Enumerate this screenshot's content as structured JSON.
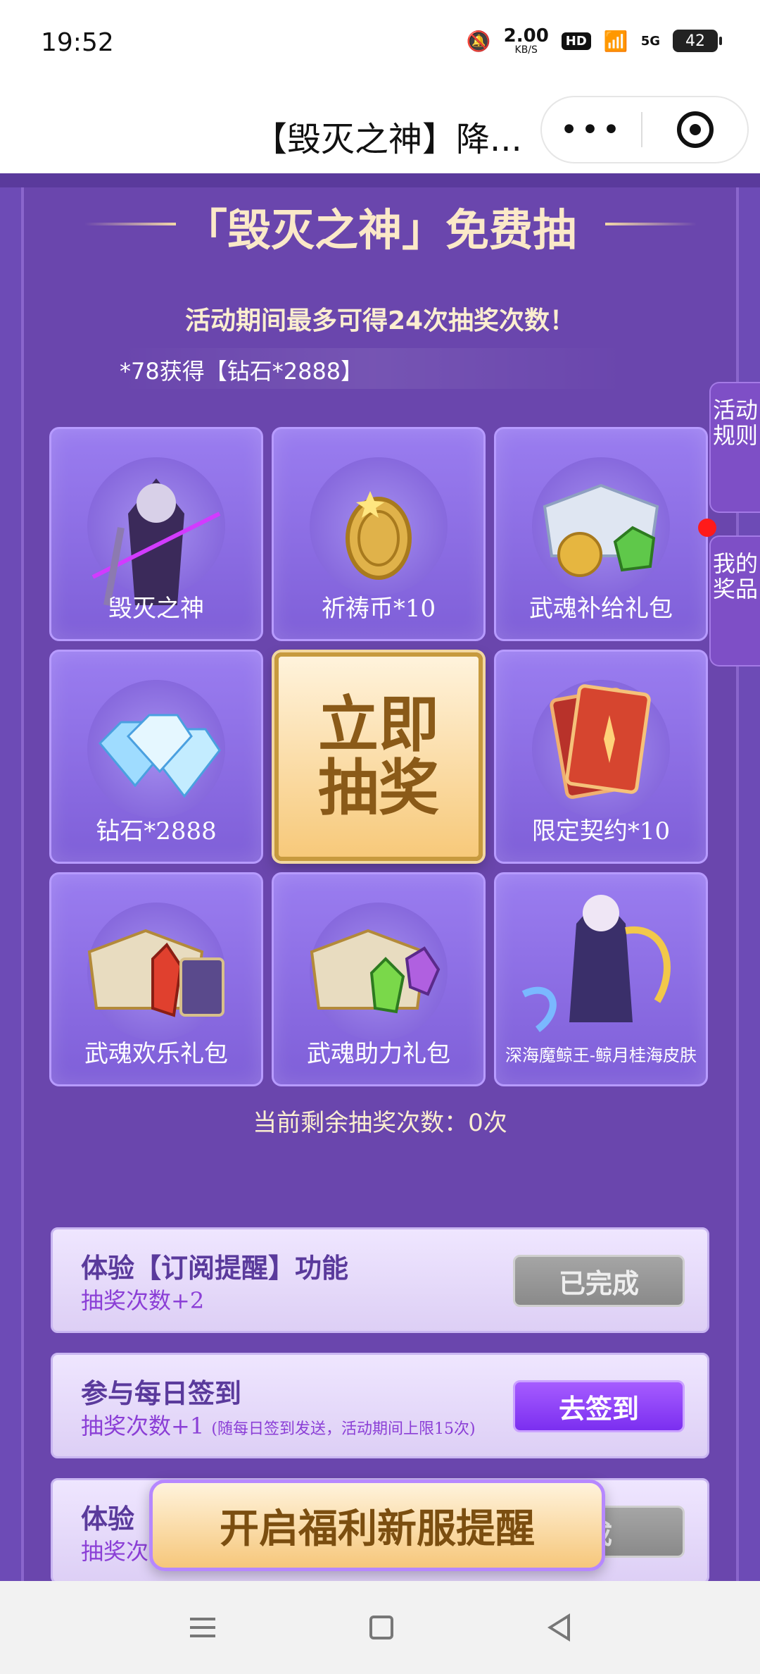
{
  "status_bar": {
    "time": "19:52",
    "net_speed_value": "2.00",
    "net_speed_unit": "KB/S",
    "hd_label": "HD",
    "signal_label": "5G",
    "battery": "42"
  },
  "title_bar": {
    "title": "【毁灭之神】降...",
    "more_glyph": "•••"
  },
  "event": {
    "title": "「毁灭之神」免费抽",
    "subtitle": "活动期间最多可得24次抽奖次数！",
    "marquee": "*78获得【钻石*2888】"
  },
  "prizes": [
    {
      "label": "毁灭之神",
      "icon": "character-icon"
    },
    {
      "label": "祈祷币*10",
      "icon": "coin-icon"
    },
    {
      "label": "武魂补给礼包",
      "icon": "chest-icon"
    },
    {
      "label": "钻石*2888",
      "icon": "diamond-icon"
    },
    {
      "label": "限定契约*10",
      "icon": "card-icon"
    },
    {
      "label": "武魂欢乐礼包",
      "icon": "chest-icon"
    },
    {
      "label": "武魂助力礼包",
      "icon": "chest-icon"
    },
    {
      "label": "深海魔鲸王-鲸月桂海皮肤",
      "icon": "skin-icon"
    }
  ],
  "draw_button": "立即抽奖",
  "remaining_text": "当前剩余抽奖次数：0次",
  "tasks": [
    {
      "title": "体验【订阅提醒】功能",
      "reward": "抽奖次数+2",
      "note": "",
      "button": "已完成",
      "state": "done"
    },
    {
      "title": "参与每日签到",
      "reward": "抽奖次数+1",
      "note": "(随每日签到发送，活动期间上限15次)",
      "button": "去签到",
      "state": "go"
    },
    {
      "title": "体验",
      "reward": "抽奖次",
      "note": "",
      "button": "成",
      "state": "done"
    }
  ],
  "side_tabs": {
    "rules": "活动规则",
    "my_prizes": "我的奖品"
  },
  "float_banner": "开启福利新服提醒",
  "colors": {
    "background": "#6a46ad",
    "gold_text": "#fbe9c8",
    "accent_purple": "#7b2ff0"
  }
}
